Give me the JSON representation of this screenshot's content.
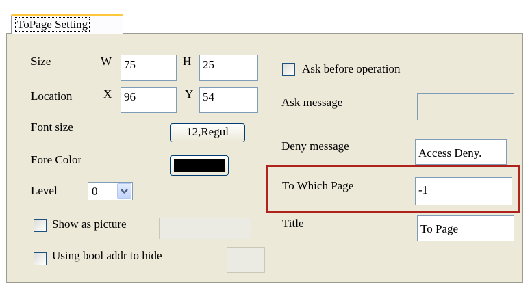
{
  "tab": {
    "label": "ToPage Setting"
  },
  "left": {
    "size_label": "Size",
    "w_label": "W",
    "w_value": "75",
    "h_label": "H",
    "h_value": "25",
    "location_label": "Location",
    "x_label": "X",
    "x_value": "96",
    "y_label": "Y",
    "y_value": "54",
    "font_size_label": "Font size",
    "font_size_button": "12,Regul",
    "fore_color_label": "Fore Color",
    "fore_color_value": "#000000",
    "level_label": "Level",
    "level_value": "0",
    "show_as_picture_label": "Show as picture",
    "bool_addr_label": "Using bool addr to hide"
  },
  "right": {
    "ask_before_label": "Ask before operation",
    "ask_message_label": "Ask message",
    "ask_message_value": "",
    "deny_message_label": "Deny message",
    "deny_message_value": "Access Deny.",
    "to_which_page_label": "To Which Page",
    "to_which_page_value": "-1",
    "title_label": "Title",
    "title_value": "To Page"
  },
  "colors": {
    "highlight": "#b0231d",
    "panel": "#ece9d8",
    "tab_accent": "#ffc83c"
  },
  "icons": {
    "dropdown": "chevron-down-icon"
  }
}
